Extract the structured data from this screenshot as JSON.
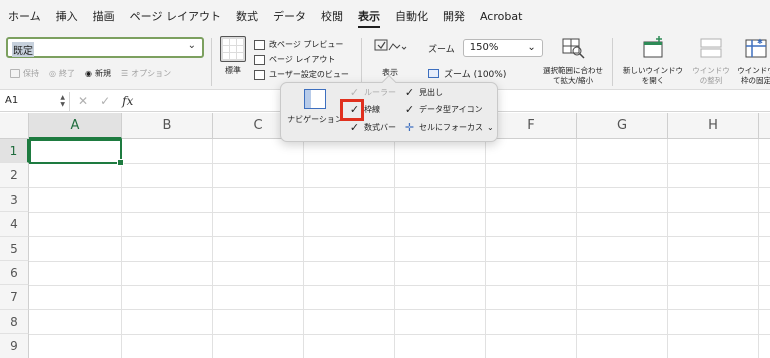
{
  "tabs": [
    "ホーム",
    "挿入",
    "描画",
    "ページ レイアウト",
    "数式",
    "データ",
    "校閲",
    "表示",
    "自動化",
    "開発",
    "Acrobat"
  ],
  "active_tab_index": 7,
  "sheetview": {
    "selected": "既定",
    "save": "保持",
    "exit": "終了",
    "new": "新規",
    "options": "オプション"
  },
  "workbook_views": {
    "normal": "標準",
    "page_break": "改ページ プレビュー",
    "page_layout": "ページ レイアウト",
    "custom": "ユーザー設定のビュー"
  },
  "show": {
    "label": "表示"
  },
  "zoom": {
    "label": "ズーム",
    "value": "150%",
    "zoom100": "ズーム (100%)",
    "fit_selection": "選択範囲に合わせて拡大/縮小"
  },
  "window": {
    "new_window": "新しいウインドウを開く",
    "arrange": "ウインドウの整列",
    "freeze": "ウインドウ枠の固定"
  },
  "formula_bar": {
    "name_box": "A1",
    "fx": "fx"
  },
  "columns": [
    "A",
    "B",
    "C",
    "D",
    "E",
    "F",
    "G",
    "H"
  ],
  "rows": [
    "1",
    "2",
    "3",
    "4",
    "5",
    "6",
    "7",
    "8",
    "9"
  ],
  "popup": {
    "navigation": "ナビゲーション",
    "ruler": "ルーラー",
    "gridlines": "枠線",
    "formula_bar": "数式バー",
    "headings": "見出し",
    "data_icons": "データ型アイコン",
    "cell_focus": "セルにフォーカス"
  },
  "colors": {
    "accent": "#1e7b40",
    "highlight": "#e0301e"
  }
}
